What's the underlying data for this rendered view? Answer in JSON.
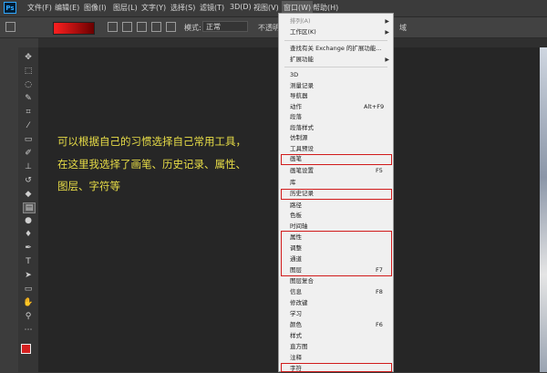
{
  "app": {
    "logo": "Ps"
  },
  "menubar": {
    "items": [
      "文件(F)",
      "编辑(E)",
      "图像(I)",
      "图层(L)",
      "文字(Y)",
      "选择(S)",
      "滤镜(T)",
      "3D(D)",
      "视图(V)",
      "窗口(W)",
      "帮助(H)"
    ],
    "active": "窗口(W)"
  },
  "options": {
    "mode_label": "模式:",
    "mode_value": "正常",
    "opacity_label": "不透明",
    "right_text": "域"
  },
  "caption": {
    "line1": "可以根据自己的习惯选择自己常用工具，",
    "line2": "在这里我选择了画笔、历史记录、属性、",
    "line3": "图层、字符等"
  },
  "window_menu": {
    "top_items": [
      {
        "label": "排列(A)",
        "arrow": true,
        "grey": true
      },
      {
        "label": "工作区(K)",
        "arrow": true
      }
    ],
    "exchange_items": [
      {
        "label": "查找有关 Exchange 的扩展功能..."
      },
      {
        "label": "扩展功能",
        "arrow": true
      }
    ],
    "panel_items": [
      {
        "label": "3D"
      },
      {
        "label": "测量记录"
      },
      {
        "label": "导航器"
      },
      {
        "label": "动作",
        "shortcut": "Alt+F9"
      },
      {
        "label": "段落"
      },
      {
        "label": "段落样式"
      },
      {
        "label": "仿制源"
      },
      {
        "label": "工具预设"
      },
      {
        "label": "画笔"
      },
      {
        "label": "画笔设置",
        "shortcut": "F5"
      },
      {
        "label": "库"
      },
      {
        "label": "历史记录"
      },
      {
        "label": "路径"
      },
      {
        "label": "色板"
      },
      {
        "label": "时间轴"
      },
      {
        "label": "属性"
      },
      {
        "label": "调整"
      },
      {
        "label": "通道"
      },
      {
        "label": "图层",
        "shortcut": "F7"
      },
      {
        "label": "图层复合"
      },
      {
        "label": "信息",
        "shortcut": "F8"
      },
      {
        "label": "修改键"
      },
      {
        "label": "学习"
      },
      {
        "label": "颜色",
        "shortcut": "F6"
      },
      {
        "label": "样式"
      },
      {
        "label": "直方图"
      },
      {
        "label": "注释"
      },
      {
        "label": "字符"
      }
    ]
  },
  "colors": {
    "highlight": "#d11b1b",
    "caption": "#e8dd47",
    "foreground_swatch": "#d42020"
  },
  "tools": [
    "move-icon",
    "marquee-icon",
    "lasso-icon",
    "quick-select-icon",
    "crop-icon",
    "eyedropper-icon",
    "healing-icon",
    "brush-icon",
    "stamp-icon",
    "history-brush-icon",
    "eraser-icon",
    "gradient-icon",
    "blur-icon",
    "dodge-icon",
    "pen-icon",
    "type-icon",
    "path-select-icon",
    "shape-icon",
    "hand-icon",
    "zoom-icon",
    "more-icon"
  ]
}
